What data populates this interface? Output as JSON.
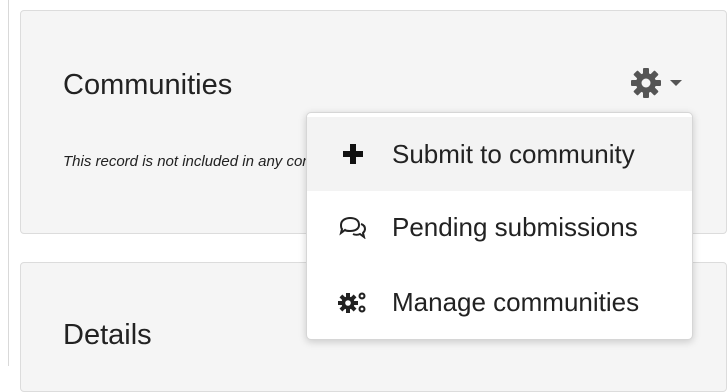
{
  "communities_card": {
    "title": "Communities",
    "status_text": "This record is not included in any communities yet.",
    "settings_menu": {
      "items": [
        {
          "label": "Submit to community",
          "icon": "plus-icon"
        },
        {
          "label": "Pending submissions",
          "icon": "comments-icon"
        },
        {
          "label": "Manage communities",
          "icon": "cogs-icon"
        }
      ]
    }
  },
  "details_card": {
    "title": "Details"
  },
  "colors": {
    "card_bg": "#f5f5f5",
    "icon_gray": "#555555",
    "hover_bg": "#f3f3f3"
  }
}
